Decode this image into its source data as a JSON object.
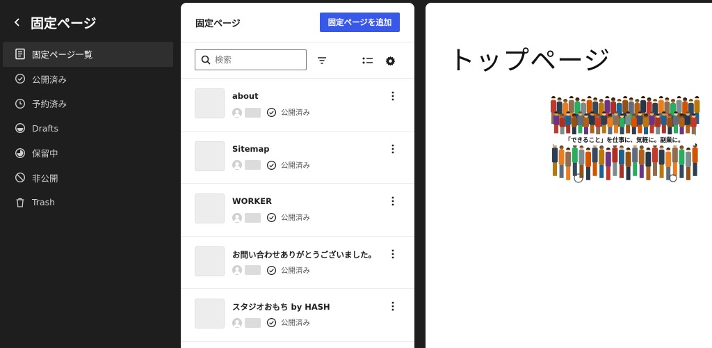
{
  "sidebar": {
    "title": "固定ページ",
    "items": [
      {
        "label": "固定ページ一覧",
        "icon": "pages-list-icon",
        "active": true
      },
      {
        "label": "公開済み",
        "icon": "published-check-icon"
      },
      {
        "label": "予約済み",
        "icon": "scheduled-clock-icon"
      },
      {
        "label": "Drafts",
        "icon": "drafts-half-circle-icon"
      },
      {
        "label": "保留中",
        "icon": "pending-icon"
      },
      {
        "label": "非公開",
        "icon": "private-no-icon"
      },
      {
        "label": "Trash",
        "icon": "trash-icon"
      }
    ]
  },
  "list": {
    "title": "固定ページ",
    "add_label": "固定ページを追加",
    "search_placeholder": "検索",
    "pages": [
      {
        "title": "about",
        "status": "公開済み"
      },
      {
        "title": "Sitemap",
        "status": "公開済み"
      },
      {
        "title": "WORKER",
        "status": "公開済み"
      },
      {
        "title": "お問い合わせありがとうございました。",
        "status": "公開済み"
      },
      {
        "title": "スタジオおもち by HASH",
        "status": "公開済み"
      }
    ]
  },
  "preview": {
    "title": "トップページ",
    "banner": "「できること」を仕事に、気軽に。副業に。"
  },
  "colors": {
    "accent": "#3858e9",
    "sidebar_bg": "#1e1e1e",
    "active_item": "#2f2f2f"
  }
}
